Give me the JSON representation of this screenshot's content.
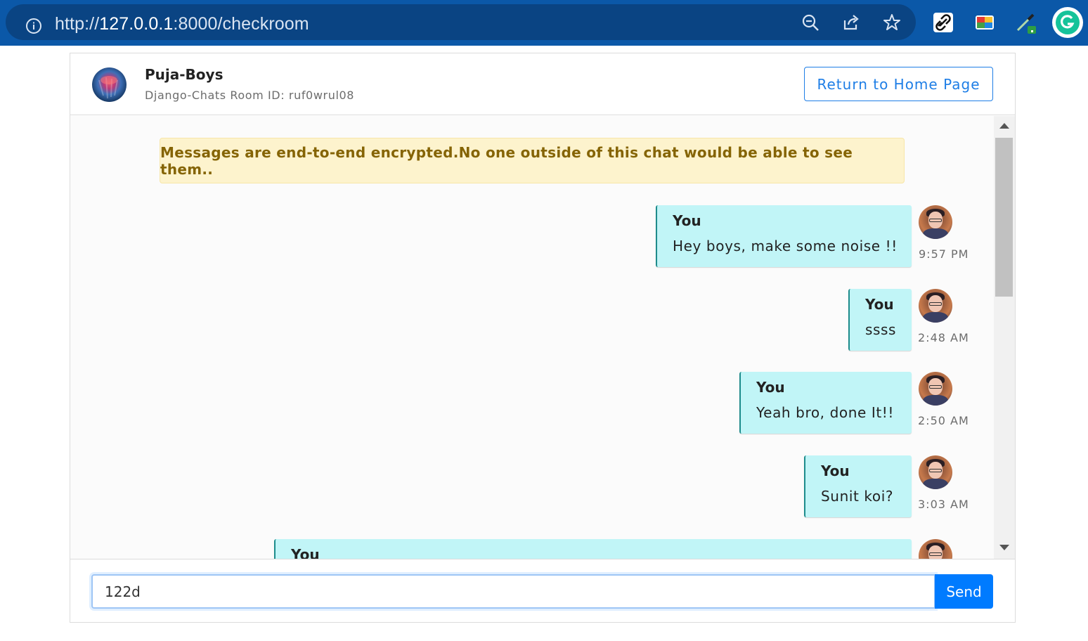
{
  "browser": {
    "url_scheme": "http://",
    "url_host": "127.0.0.1",
    "url_path": ":8000/checkroom",
    "icons": [
      "info-icon",
      "zoom-out-icon",
      "share-icon",
      "star-icon",
      "link-extension-icon",
      "color-extension-icon",
      "eyedropper-extension-icon",
      "grammarly-extension-icon"
    ]
  },
  "header": {
    "room_name": "Puja-Boys",
    "room_id_label": "Django-Chats Room ID: ruf0wrul08",
    "home_button": "Return to Home Page"
  },
  "alert": {
    "text": "Messages are end-to-end encrypted.No one outside of this chat would be able to see them.."
  },
  "messages": [
    {
      "sender": "You",
      "text": "Hey boys, make some noise !!",
      "time": "9:57 PM"
    },
    {
      "sender": "You",
      "text": "ssss",
      "time": "2:48 AM"
    },
    {
      "sender": "You",
      "text": "Yeah bro, done It!!",
      "time": "2:50 AM"
    },
    {
      "sender": "You",
      "text": "Sunit koi?",
      "time": "3:03 AM"
    },
    {
      "sender": "You",
      "text": "",
      "time": ""
    }
  ],
  "composer": {
    "input_value": "122d",
    "send_label": "Send"
  },
  "colors": {
    "browser_bar": "#0b58a8",
    "bubble": "#c1f5f7",
    "alert_bg": "#fdf3cd",
    "alert_text": "#856404",
    "primary": "#007bff"
  }
}
